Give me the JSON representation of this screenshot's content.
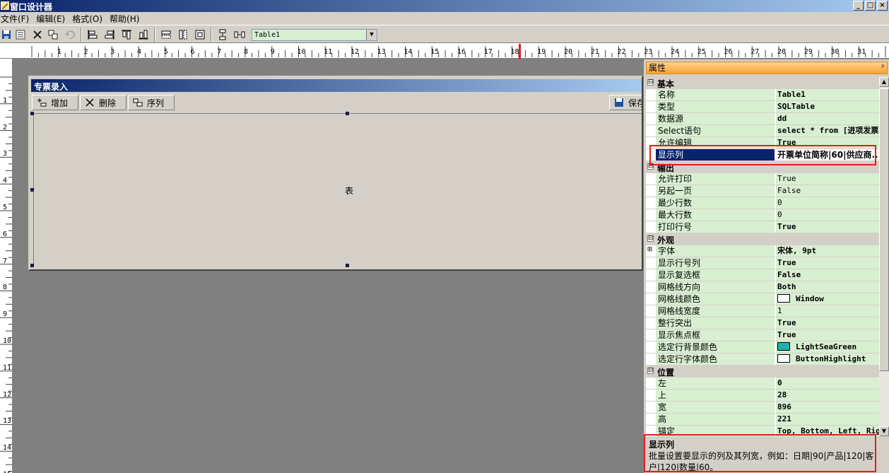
{
  "window": {
    "title": "窗口设计器",
    "controls": [
      "_",
      "□",
      "×"
    ]
  },
  "menu": [
    "文件(F)",
    "编辑(E)",
    "格式(O)",
    "帮助(H)"
  ],
  "toolbar": {
    "buttons": [
      "save-icon",
      "properties-icon",
      "delete-icon",
      "copy-icon",
      "undo-icon",
      "align-left-icon",
      "align-right-icon",
      "align-top-icon",
      "align-bottom-icon",
      "same-width-icon",
      "same-height-icon",
      "same-size-icon",
      "vertical-spacing-icon",
      "horizontal-spacing-icon"
    ],
    "combo_value": "Table1"
  },
  "ruler": {
    "h_numbers": [
      "1",
      "2",
      "3",
      "4",
      "5",
      "6",
      "7",
      "8",
      "9",
      "10",
      "11",
      "12",
      "13",
      "14",
      "15",
      "16",
      "17",
      "18",
      "19",
      "20",
      "21",
      "22",
      "23",
      "24",
      "25",
      "26",
      "27",
      "28",
      "29",
      "30",
      "31"
    ],
    "v_numbers": [
      "1",
      "2",
      "3",
      "4",
      "5",
      "6",
      "7",
      "8",
      "9",
      "10",
      "11",
      "12",
      "13",
      "14",
      "15"
    ]
  },
  "form": {
    "title": "专票录入",
    "buttons": [
      {
        "label": "增加",
        "icon": "add-icon"
      },
      {
        "label": "删除",
        "icon": "delete-icon"
      },
      {
        "label": "序列",
        "icon": "sequence-icon"
      }
    ],
    "save_button": "保存",
    "table_label": "表"
  },
  "properties": {
    "header": "属性",
    "pin": "ᵖ",
    "rows": [
      {
        "type": "cat",
        "name": "基本",
        "expander": "⊟"
      },
      {
        "name": "名称",
        "value": "Table1"
      },
      {
        "name": "类型",
        "value": "SQLTable"
      },
      {
        "name": "数据源",
        "value": "dd"
      },
      {
        "name": "Select语句",
        "value": "select * from [进项发票]"
      },
      {
        "name": "允许编辑",
        "value": "True"
      },
      {
        "name": "显示列",
        "value": "开票单位简称|60|供应商...",
        "selected": true
      },
      {
        "type": "cat",
        "name": "输出",
        "expander": "⊟"
      },
      {
        "name": "允许打印",
        "value": "True",
        "normal": true
      },
      {
        "name": "另起一页",
        "value": "False",
        "normal": true
      },
      {
        "name": "最少行数",
        "value": "0",
        "normal": true
      },
      {
        "name": "最大行数",
        "value": "0",
        "normal": true
      },
      {
        "name": "打印行号",
        "value": "True"
      },
      {
        "type": "cat",
        "name": "外观",
        "expander": "⊟"
      },
      {
        "name": "字体",
        "value": "宋体, 9pt",
        "expander": "⊞"
      },
      {
        "name": "显示行号列",
        "value": "True"
      },
      {
        "name": "显示复选框",
        "value": "False"
      },
      {
        "name": "网格线方向",
        "value": "Both"
      },
      {
        "name": "网格线颜色",
        "value": "Window",
        "swatch": "#ffffff"
      },
      {
        "name": "网格线宽度",
        "value": "1",
        "normal": true
      },
      {
        "name": "整行突出",
        "value": "True"
      },
      {
        "name": "显示焦点框",
        "value": "True"
      },
      {
        "name": "选定行背景颜色",
        "value": "LightSeaGreen",
        "swatch": "#20b2aa"
      },
      {
        "name": "选定行字体颜色",
        "value": "ButtonHighlight",
        "swatch": "#ffffff"
      },
      {
        "type": "cat",
        "name": "位置",
        "expander": "⊟"
      },
      {
        "name": "左",
        "value": "0"
      },
      {
        "name": "上",
        "value": "28"
      },
      {
        "name": "宽",
        "value": "896"
      },
      {
        "name": "高",
        "value": "221"
      },
      {
        "name": "锚定",
        "value": "Top, Bottom, Left, Right"
      }
    ],
    "description": {
      "title": "显示列",
      "text": "批量设置要显示的列及其列宽，例如：日期|90|产品|120|客户|120|数量|60。"
    }
  },
  "colors": {
    "title_start": "#0a246a",
    "title_end": "#a6caf0",
    "prop_bg": "#d8efd2",
    "selection": "#0a246a",
    "annotation": "#e0201c",
    "header_orange": "#f7a437"
  }
}
